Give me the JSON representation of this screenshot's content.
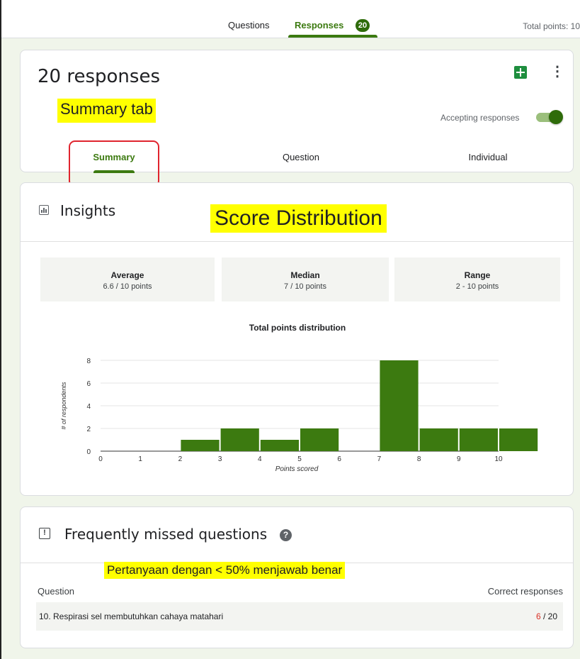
{
  "top_tabs": {
    "questions": "Questions",
    "responses": "Responses",
    "responses_count": "20",
    "total_points": "Total points: 10"
  },
  "summary_card": {
    "title": "20 responses",
    "accepting_label": "Accepting responses",
    "accepting_on": true,
    "tabs": [
      "Summary",
      "Question",
      "Individual"
    ],
    "annotation": "Summary tab"
  },
  "insights": {
    "title": "Insights",
    "annotation": "Score Distribution",
    "stats": [
      {
        "label": "Average",
        "value": "6.6 / 10 points"
      },
      {
        "label": "Median",
        "value": "7 / 10 points"
      },
      {
        "label": "Range",
        "value": "2 - 10 points"
      }
    ]
  },
  "chart_data": {
    "type": "bar",
    "title": "Total points distribution",
    "xlabel": "Points scored",
    "ylabel": "# of respondents",
    "categories": [
      "0",
      "1",
      "2",
      "3",
      "4",
      "5",
      "6",
      "7",
      "8",
      "9",
      "10"
    ],
    "values": [
      0,
      0,
      1,
      2,
      1,
      2,
      0,
      8,
      2,
      2,
      2
    ],
    "ylim": [
      0,
      8
    ],
    "yticks": [
      0,
      2,
      4,
      6,
      8
    ],
    "color": "#3c7a10",
    "grid": true
  },
  "missed": {
    "title": "Frequently missed questions",
    "annotation": "Pertanyaan  dengan  < 50% menjawab  benar",
    "col_question": "Question",
    "col_correct": "Correct responses",
    "rows": [
      {
        "question": "10. Respirasi sel membutuhkan cahaya matahari",
        "correct": "6",
        "total": " / 20"
      }
    ]
  }
}
